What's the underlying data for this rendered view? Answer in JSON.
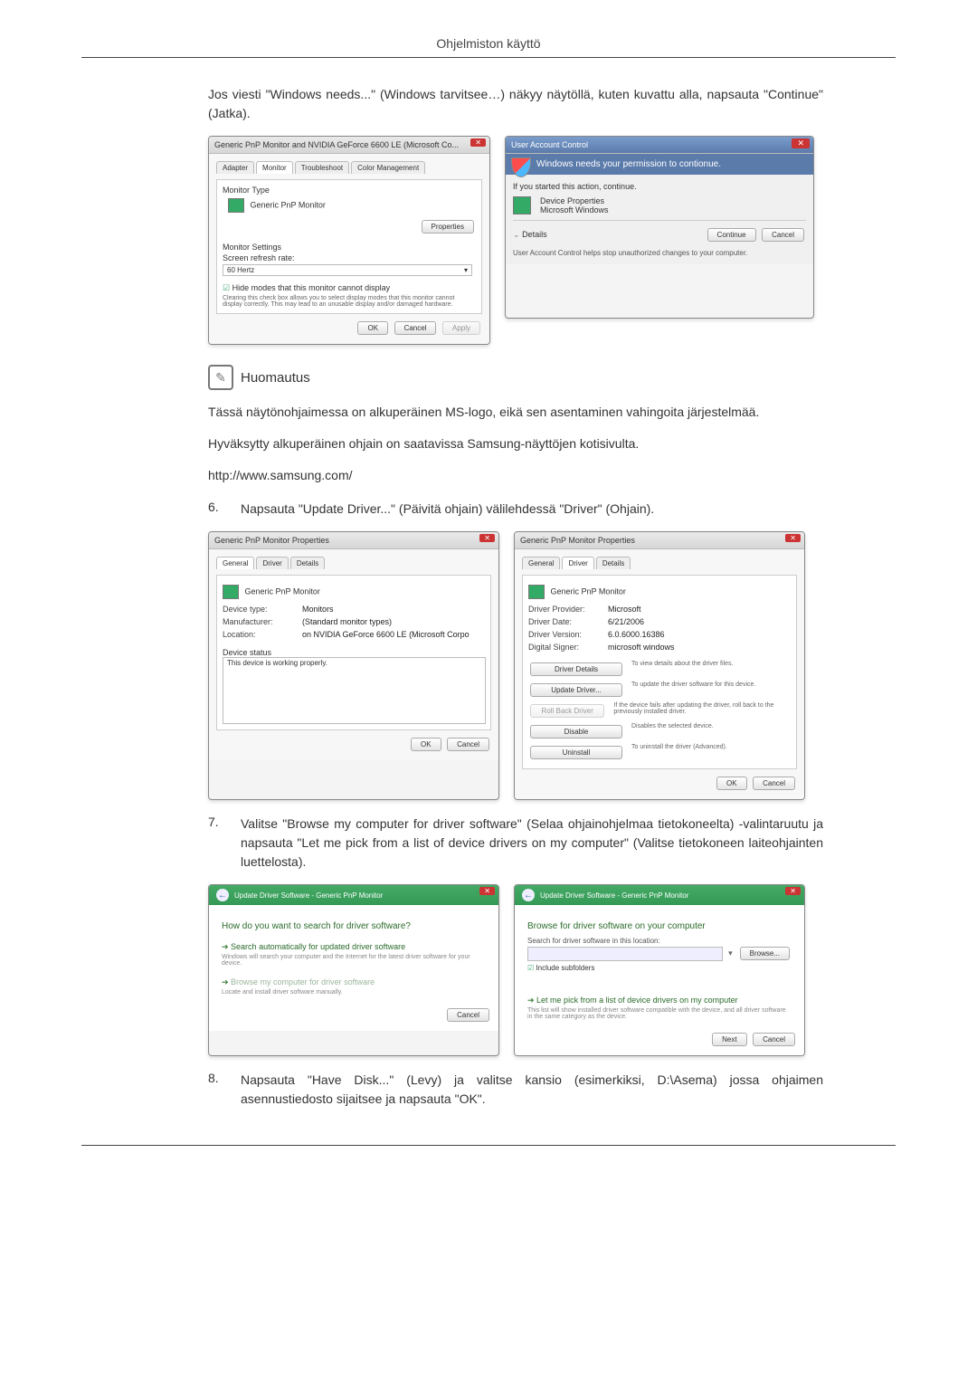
{
  "header": {
    "title": "Ohjelmiston käyttö"
  },
  "intro": "Jos viesti \"Windows needs...\" (Windows tarvitsee…) näkyy näytöllä, kuten kuvattu alla, napsauta \"Continue\" (Jatka).",
  "shot1": {
    "title": "Generic PnP Monitor and NVIDIA GeForce 6600 LE (Microsoft Co...",
    "tabs": {
      "t1": "Adapter",
      "t2": "Monitor",
      "t3": "Troubleshoot",
      "t4": "Color Management"
    },
    "section1_head": "Monitor Type",
    "monitor_name": "Generic PnP Monitor",
    "btn_props": "Properties",
    "section2_head": "Monitor Settings",
    "refresh_lbl": "Screen refresh rate:",
    "refresh_val": "60 Hertz",
    "hide_modes": "Hide modes that this monitor cannot display",
    "hide_desc": "Clearing this check box allows you to select display modes that this monitor cannot display correctly. This may lead to an unusable display and/or damaged hardware.",
    "ok": "OK",
    "cancel": "Cancel",
    "apply": "Apply"
  },
  "uac": {
    "title": "User Account Control",
    "headline": "Windows needs your permission to contionue.",
    "sub": "If you started this action, continue.",
    "app_name": "Device Properties",
    "app_pub": "Microsoft Windows",
    "details": "Details",
    "continue": "Continue",
    "cancel": "Cancel",
    "footer": "User Account Control helps stop unauthorized changes to your computer."
  },
  "note": {
    "title": "Huomautus",
    "p1": "Tässä näytönohjaimessa on alkuperäinen MS-logo, eikä sen asentaminen vahingoita järjestelmää.",
    "p2": "Hyväksytty alkuperäinen ohjain on saatavissa Samsung-näyttöjen kotisivulta.",
    "p3": "http://www.samsung.com/"
  },
  "step6": {
    "num": "6.",
    "txt": "Napsauta \"Update Driver...\" (Päivitä ohjain) välilehdessä \"Driver\" (Ohjain)."
  },
  "shot2a": {
    "title": "Generic PnP Monitor Properties",
    "tabs": {
      "t1": "General",
      "t2": "Driver",
      "t3": "Details"
    },
    "name": "Generic PnP Monitor",
    "r1l": "Device type:",
    "r1v": "Monitors",
    "r2l": "Manufacturer:",
    "r2v": "(Standard monitor types)",
    "r3l": "Location:",
    "r3v": "on NVIDIA GeForce 6600 LE (Microsoft Corpo",
    "status_head": "Device status",
    "status": "This device is working properly.",
    "ok": "OK",
    "cancel": "Cancel"
  },
  "shot2b": {
    "title": "Generic PnP Monitor Properties",
    "tabs": {
      "t1": "General",
      "t2": "Driver",
      "t3": "Details"
    },
    "name": "Generic PnP Monitor",
    "r1l": "Driver Provider:",
    "r1v": "Microsoft",
    "r2l": "Driver Date:",
    "r2v": "6/21/2006",
    "r3l": "Driver Version:",
    "r3v": "6.0.6000.16386",
    "r4l": "Digital Signer:",
    "r4v": "microsoft windows",
    "b1": "Driver Details",
    "b1d": "To view details about the driver files.",
    "b2": "Update Driver...",
    "b2d": "To update the driver software for this device.",
    "b3": "Roll Back Driver",
    "b3d": "If the device fails after updating the driver, roll back to the previously installed driver.",
    "b4": "Disable",
    "b4d": "Disables the selected device.",
    "b5": "Uninstall",
    "b5d": "To uninstall the driver (Advanced).",
    "ok": "OK",
    "cancel": "Cancel"
  },
  "step7": {
    "num": "7.",
    "txt": "Valitse \"Browse my computer for driver software\" (Selaa ohjainohjelmaa tietokoneelta) -valintaruutu ja napsauta \"Let me pick from a list of device drivers on my computer\" (Va­litse tietokoneen laiteohjainten luettelosta)."
  },
  "shot3a": {
    "back": "←",
    "crumb": "Update Driver Software - Generic PnP Monitor",
    "q": "How do you want to search for driver software?",
    "o1": "Search automatically for updated driver software",
    "o1s": "Windows will search your computer and the Internet for the latest driver software for your device.",
    "o2": "Browse my computer for driver software",
    "o2s": "Locate and install driver software manually.",
    "cancel": "Cancel"
  },
  "shot3b": {
    "back": "←",
    "crumb": "Update Driver Software - Generic PnP Monitor",
    "q": "Browse for driver software on your computer",
    "loc_lbl": "Search for driver software in this location:",
    "browse": "Browse...",
    "include": "Include subfolders",
    "o1": "Let me pick from a list of device drivers on my computer",
    "o1s": "This list will show installed driver software compatible with the device, and all driver software in the same category as the device.",
    "next": "Next",
    "cancel": "Cancel"
  },
  "step8": {
    "num": "8.",
    "txt": "Napsauta \"Have Disk...\" (Levy) ja valitse kansio (esimerkiksi, D:\\Asema) jossa ohjaimen asennustiedosto sijaitsee ja napsauta \"OK\"."
  }
}
